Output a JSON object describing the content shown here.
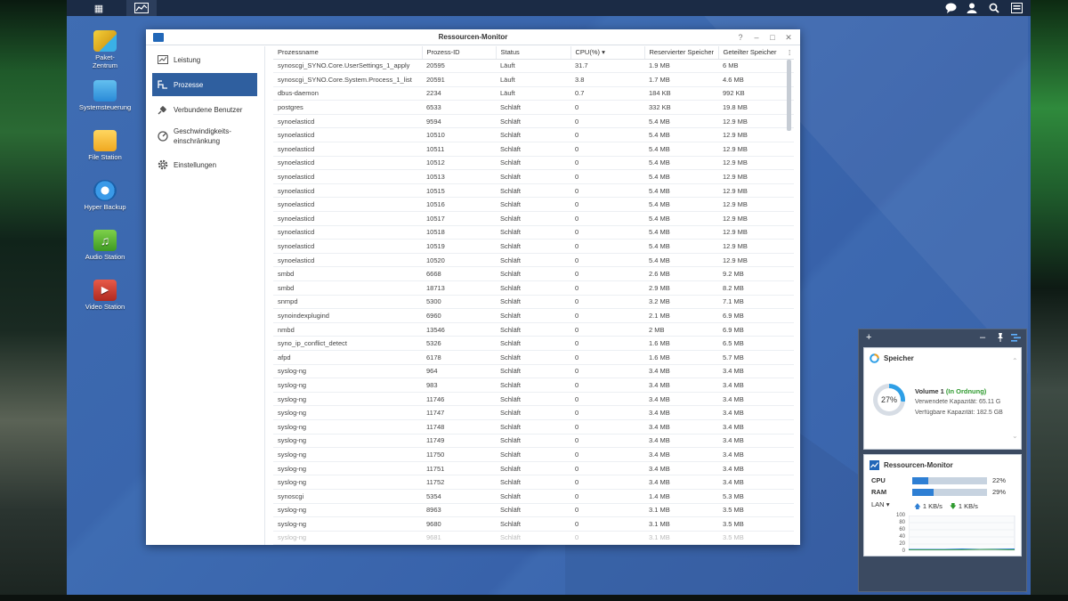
{
  "taskbar": {
    "main_menu_icon": "grid-icon",
    "active_app_icon": "resource-monitor-icon",
    "right_icons": [
      "chat-icon",
      "user-icon",
      "search-icon",
      "widgets-icon"
    ]
  },
  "desktop_icons": [
    {
      "label": "Paket-\nZentrum",
      "icon": "package-icon",
      "color": "#e8c030"
    },
    {
      "label": "Systemsteuerung",
      "icon": "control-panel-icon",
      "color": "#3aa0e0"
    },
    {
      "label": "File Station",
      "icon": "folder-icon",
      "color": "#f0b830"
    },
    {
      "label": "Hyper Backup",
      "icon": "backup-icon",
      "color": "#2a8ad8"
    },
    {
      "label": "Audio Station",
      "icon": "music-icon",
      "color": "#5cb832"
    },
    {
      "label": "Video Station",
      "icon": "video-icon",
      "color": "#d03a30"
    }
  ],
  "window": {
    "title": "Ressourcen-Monitor",
    "controls": [
      "?",
      "–",
      "□",
      "✕"
    ],
    "nav": [
      {
        "label": "Leistung",
        "icon": "chart-icon",
        "active": false
      },
      {
        "label": "Prozesse",
        "icon": "process-icon",
        "active": true
      },
      {
        "label": "Verbundene Benutzer",
        "icon": "plug-icon",
        "active": false
      },
      {
        "label": "Geschwindigkeits-",
        "label2": "einschränkung",
        "icon": "speed-limit-icon",
        "active": false
      },
      {
        "label": "Einstellungen",
        "icon": "gear-icon",
        "active": false
      }
    ],
    "columns": [
      "Prozessname",
      "Prozess-ID",
      "Status",
      "CPU(%)",
      "Reservierter Speicher",
      "Geteilter Speicher"
    ],
    "sort_indicator": "▾",
    "rows": [
      [
        "synoscgi_SYNO.Core.UserSettings_1_apply",
        "20595",
        "Läuft",
        "31.7",
        "1.9 MB",
        "6 MB"
      ],
      [
        "synoscgi_SYNO.Core.System.Process_1_list",
        "20591",
        "Läuft",
        "3.8",
        "1.7 MB",
        "4.6 MB"
      ],
      [
        "dbus-daemon",
        "2234",
        "Läuft",
        "0.7",
        "184 KB",
        "992 KB"
      ],
      [
        "postgres",
        "6533",
        "Schläft",
        "0",
        "332 KB",
        "19.8 MB"
      ],
      [
        "synoelasticd",
        "9594",
        "Schläft",
        "0",
        "5.4 MB",
        "12.9 MB"
      ],
      [
        "synoelasticd",
        "10510",
        "Schläft",
        "0",
        "5.4 MB",
        "12.9 MB"
      ],
      [
        "synoelasticd",
        "10511",
        "Schläft",
        "0",
        "5.4 MB",
        "12.9 MB"
      ],
      [
        "synoelasticd",
        "10512",
        "Schläft",
        "0",
        "5.4 MB",
        "12.9 MB"
      ],
      [
        "synoelasticd",
        "10513",
        "Schläft",
        "0",
        "5.4 MB",
        "12.9 MB"
      ],
      [
        "synoelasticd",
        "10515",
        "Schläft",
        "0",
        "5.4 MB",
        "12.9 MB"
      ],
      [
        "synoelasticd",
        "10516",
        "Schläft",
        "0",
        "5.4 MB",
        "12.9 MB"
      ],
      [
        "synoelasticd",
        "10517",
        "Schläft",
        "0",
        "5.4 MB",
        "12.9 MB"
      ],
      [
        "synoelasticd",
        "10518",
        "Schläft",
        "0",
        "5.4 MB",
        "12.9 MB"
      ],
      [
        "synoelasticd",
        "10519",
        "Schläft",
        "0",
        "5.4 MB",
        "12.9 MB"
      ],
      [
        "synoelasticd",
        "10520",
        "Schläft",
        "0",
        "5.4 MB",
        "12.9 MB"
      ],
      [
        "smbd",
        "6668",
        "Schläft",
        "0",
        "2.6 MB",
        "9.2 MB"
      ],
      [
        "smbd",
        "18713",
        "Schläft",
        "0",
        "2.9 MB",
        "8.2 MB"
      ],
      [
        "snmpd",
        "5300",
        "Schläft",
        "0",
        "3.2 MB",
        "7.1 MB"
      ],
      [
        "synoindexplugind",
        "6960",
        "Schläft",
        "0",
        "2.1 MB",
        "6.9 MB"
      ],
      [
        "nmbd",
        "13546",
        "Schläft",
        "0",
        "2 MB",
        "6.9 MB"
      ],
      [
        "syno_ip_conflict_detect",
        "5326",
        "Schläft",
        "0",
        "1.6 MB",
        "6.5 MB"
      ],
      [
        "afpd",
        "6178",
        "Schläft",
        "0",
        "1.6 MB",
        "5.7 MB"
      ],
      [
        "syslog-ng",
        "964",
        "Schläft",
        "0",
        "3.4 MB",
        "3.4 MB"
      ],
      [
        "syslog-ng",
        "983",
        "Schläft",
        "0",
        "3.4 MB",
        "3.4 MB"
      ],
      [
        "syslog-ng",
        "11746",
        "Schläft",
        "0",
        "3.4 MB",
        "3.4 MB"
      ],
      [
        "syslog-ng",
        "11747",
        "Schläft",
        "0",
        "3.4 MB",
        "3.4 MB"
      ],
      [
        "syslog-ng",
        "11748",
        "Schläft",
        "0",
        "3.4 MB",
        "3.4 MB"
      ],
      [
        "syslog-ng",
        "11749",
        "Schläft",
        "0",
        "3.4 MB",
        "3.4 MB"
      ],
      [
        "syslog-ng",
        "11750",
        "Schläft",
        "0",
        "3.4 MB",
        "3.4 MB"
      ],
      [
        "syslog-ng",
        "11751",
        "Schläft",
        "0",
        "3.4 MB",
        "3.4 MB"
      ],
      [
        "syslog-ng",
        "11752",
        "Schläft",
        "0",
        "3.4 MB",
        "3.4 MB"
      ],
      [
        "synoscgi",
        "5354",
        "Schläft",
        "0",
        "1.4 MB",
        "5.3 MB"
      ],
      [
        "syslog-ng",
        "8963",
        "Schläft",
        "0",
        "3.1 MB",
        "3.5 MB"
      ],
      [
        "syslog-ng",
        "9680",
        "Schläft",
        "0",
        "3.1 MB",
        "3.5 MB"
      ],
      [
        "syslog-ng",
        "9681",
        "Schläft",
        "0",
        "3.1 MB",
        "3.5 MB"
      ]
    ]
  },
  "widget_panel": {
    "add": "+",
    "controls": [
      "–",
      "pin-icon",
      "widget-menu-icon"
    ],
    "storage": {
      "title": "Speicher",
      "percent_value": 27,
      "percent_label": "27%",
      "volume": "Volume 1",
      "status": "(In Ordnung)",
      "status_color": "#2e9a2e",
      "used": "Verwendete Kapazität: 65.11 G",
      "free": "Verfügbare Kapazität: 182.5 GB"
    },
    "resource": {
      "title": "Ressourcen-Monitor",
      "cpu_label": "CPU",
      "cpu_value": 22,
      "cpu_text": "22%",
      "ram_label": "RAM",
      "ram_value": 29,
      "ram_text": "29%",
      "lan_label": "LAN",
      "lan_up": "1 KB/s",
      "lan_down": "1 KB/s",
      "graph_ticks": [
        "100",
        "80",
        "60",
        "40",
        "20",
        "0"
      ]
    }
  }
}
